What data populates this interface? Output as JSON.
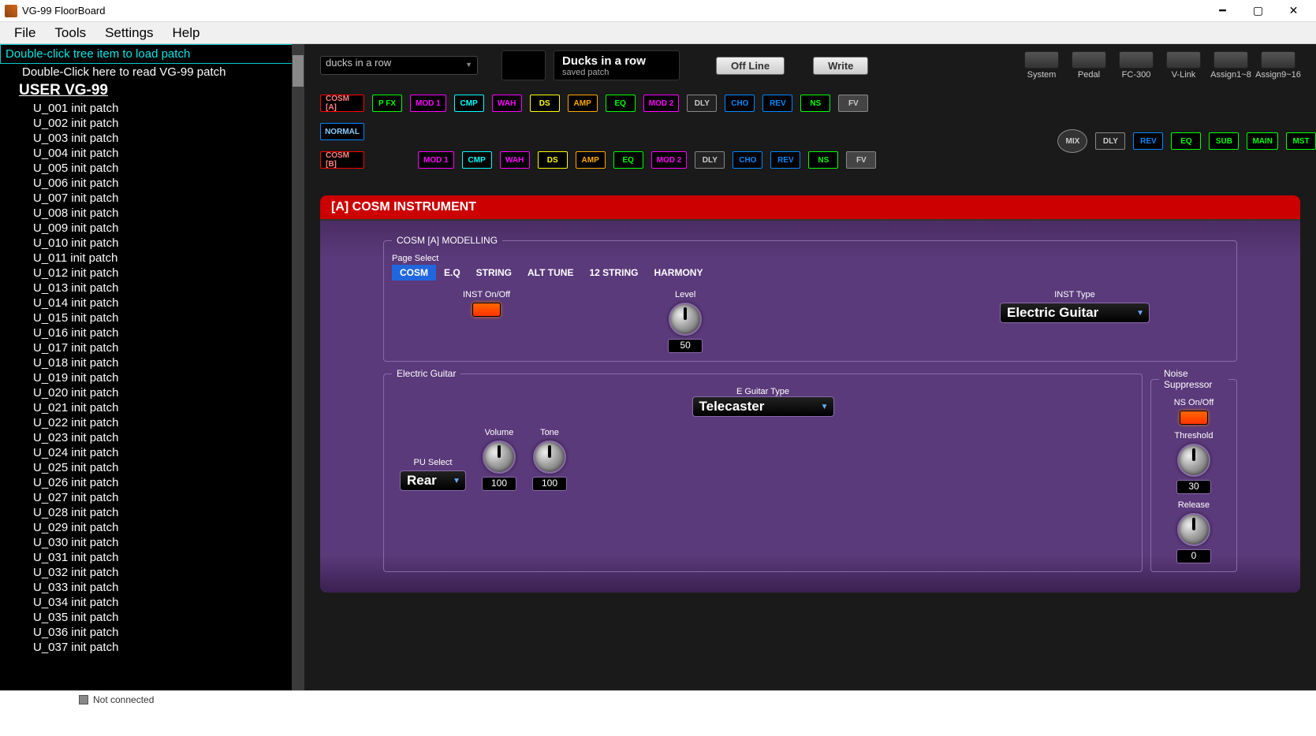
{
  "window": {
    "title": "VG-99 FloorBoard"
  },
  "menubar": [
    "File",
    "Tools",
    "Settings",
    "Help"
  ],
  "sidebar": {
    "header": "Double-click tree item to load patch",
    "read_line": "Double-Click here to read VG-99 patch",
    "user_line": "USER VG-99",
    "patches": [
      "U_001 init patch",
      "U_002 init patch",
      "U_003 init patch",
      "U_004 init patch",
      "U_005 init patch",
      "U_006 init patch",
      "U_007 init patch",
      "U_008 init patch",
      "U_009 init patch",
      "U_010 init patch",
      "U_011 init patch",
      "U_012 init patch",
      "U_013 init patch",
      "U_014 init patch",
      "U_015 init patch",
      "U_016 init patch",
      "U_017 init patch",
      "U_018 init patch",
      "U_019 init patch",
      "U_020 init patch",
      "U_021 init patch",
      "U_022 init patch",
      "U_023 init patch",
      "U_024 init patch",
      "U_025 init patch",
      "U_026 init patch",
      "U_027 init patch",
      "U_028 init patch",
      "U_029 init patch",
      "U_030 init patch",
      "U_031 init patch",
      "U_032 init patch",
      "U_033 init patch",
      "U_034 init patch",
      "U_035 init patch",
      "U_036 init patch",
      "U_037 init patch"
    ]
  },
  "toolbar": {
    "patch_select": "ducks in a row",
    "patch_name": "Ducks in a row",
    "patch_status": "saved patch",
    "offline": "Off Line",
    "write": "Write",
    "utils": [
      "System",
      "Pedal",
      "FC-300",
      "V-Link",
      "Assign1~8",
      "Assign9~16"
    ]
  },
  "chain": {
    "a": [
      "COSM [A]",
      "P FX",
      "MOD 1",
      "CMP",
      "WAH",
      "DS",
      "AMP",
      "EQ",
      "MOD 2",
      "DLY",
      "CHO",
      "REV",
      "NS",
      "FV"
    ],
    "mid": "NORMAL",
    "b": [
      "COSM [B]",
      "MOD 1",
      "CMP",
      "WAH",
      "DS",
      "AMP",
      "EQ",
      "MOD 2",
      "DLY",
      "CHO",
      "REV",
      "NS",
      "FV"
    ],
    "out": [
      "MIX",
      "DLY",
      "REV",
      "EQ",
      "SUB",
      "MAIN",
      "MST"
    ]
  },
  "editor": {
    "title": "[A] COSM INSTRUMENT",
    "modelling_legend": "COSM [A] MODELLING",
    "page_select_label": "Page Select",
    "tabs": [
      "COSM",
      "E.Q",
      "STRING",
      "ALT TUNE",
      "12 STRING",
      "HARMONY"
    ],
    "inst_onoff_label": "INST On/Off",
    "level_label": "Level",
    "level_value": "50",
    "inst_type_label": "INST Type",
    "inst_type_value": "Electric Guitar",
    "eg_legend": "Electric Guitar",
    "eg_type_label": "E Guitar Type",
    "eg_type_value": "Telecaster",
    "pu_select_label": "PU Select",
    "pu_select_value": "Rear",
    "volume_label": "Volume",
    "volume_value": "100",
    "tone_label": "Tone",
    "tone_value": "100",
    "ns_legend": "Noise Suppressor",
    "ns_onoff_label": "NS On/Off",
    "threshold_label": "Threshold",
    "threshold_value": "30",
    "release_label": "Release",
    "release_value": "0"
  },
  "statusbar": {
    "text": "Not connected"
  }
}
